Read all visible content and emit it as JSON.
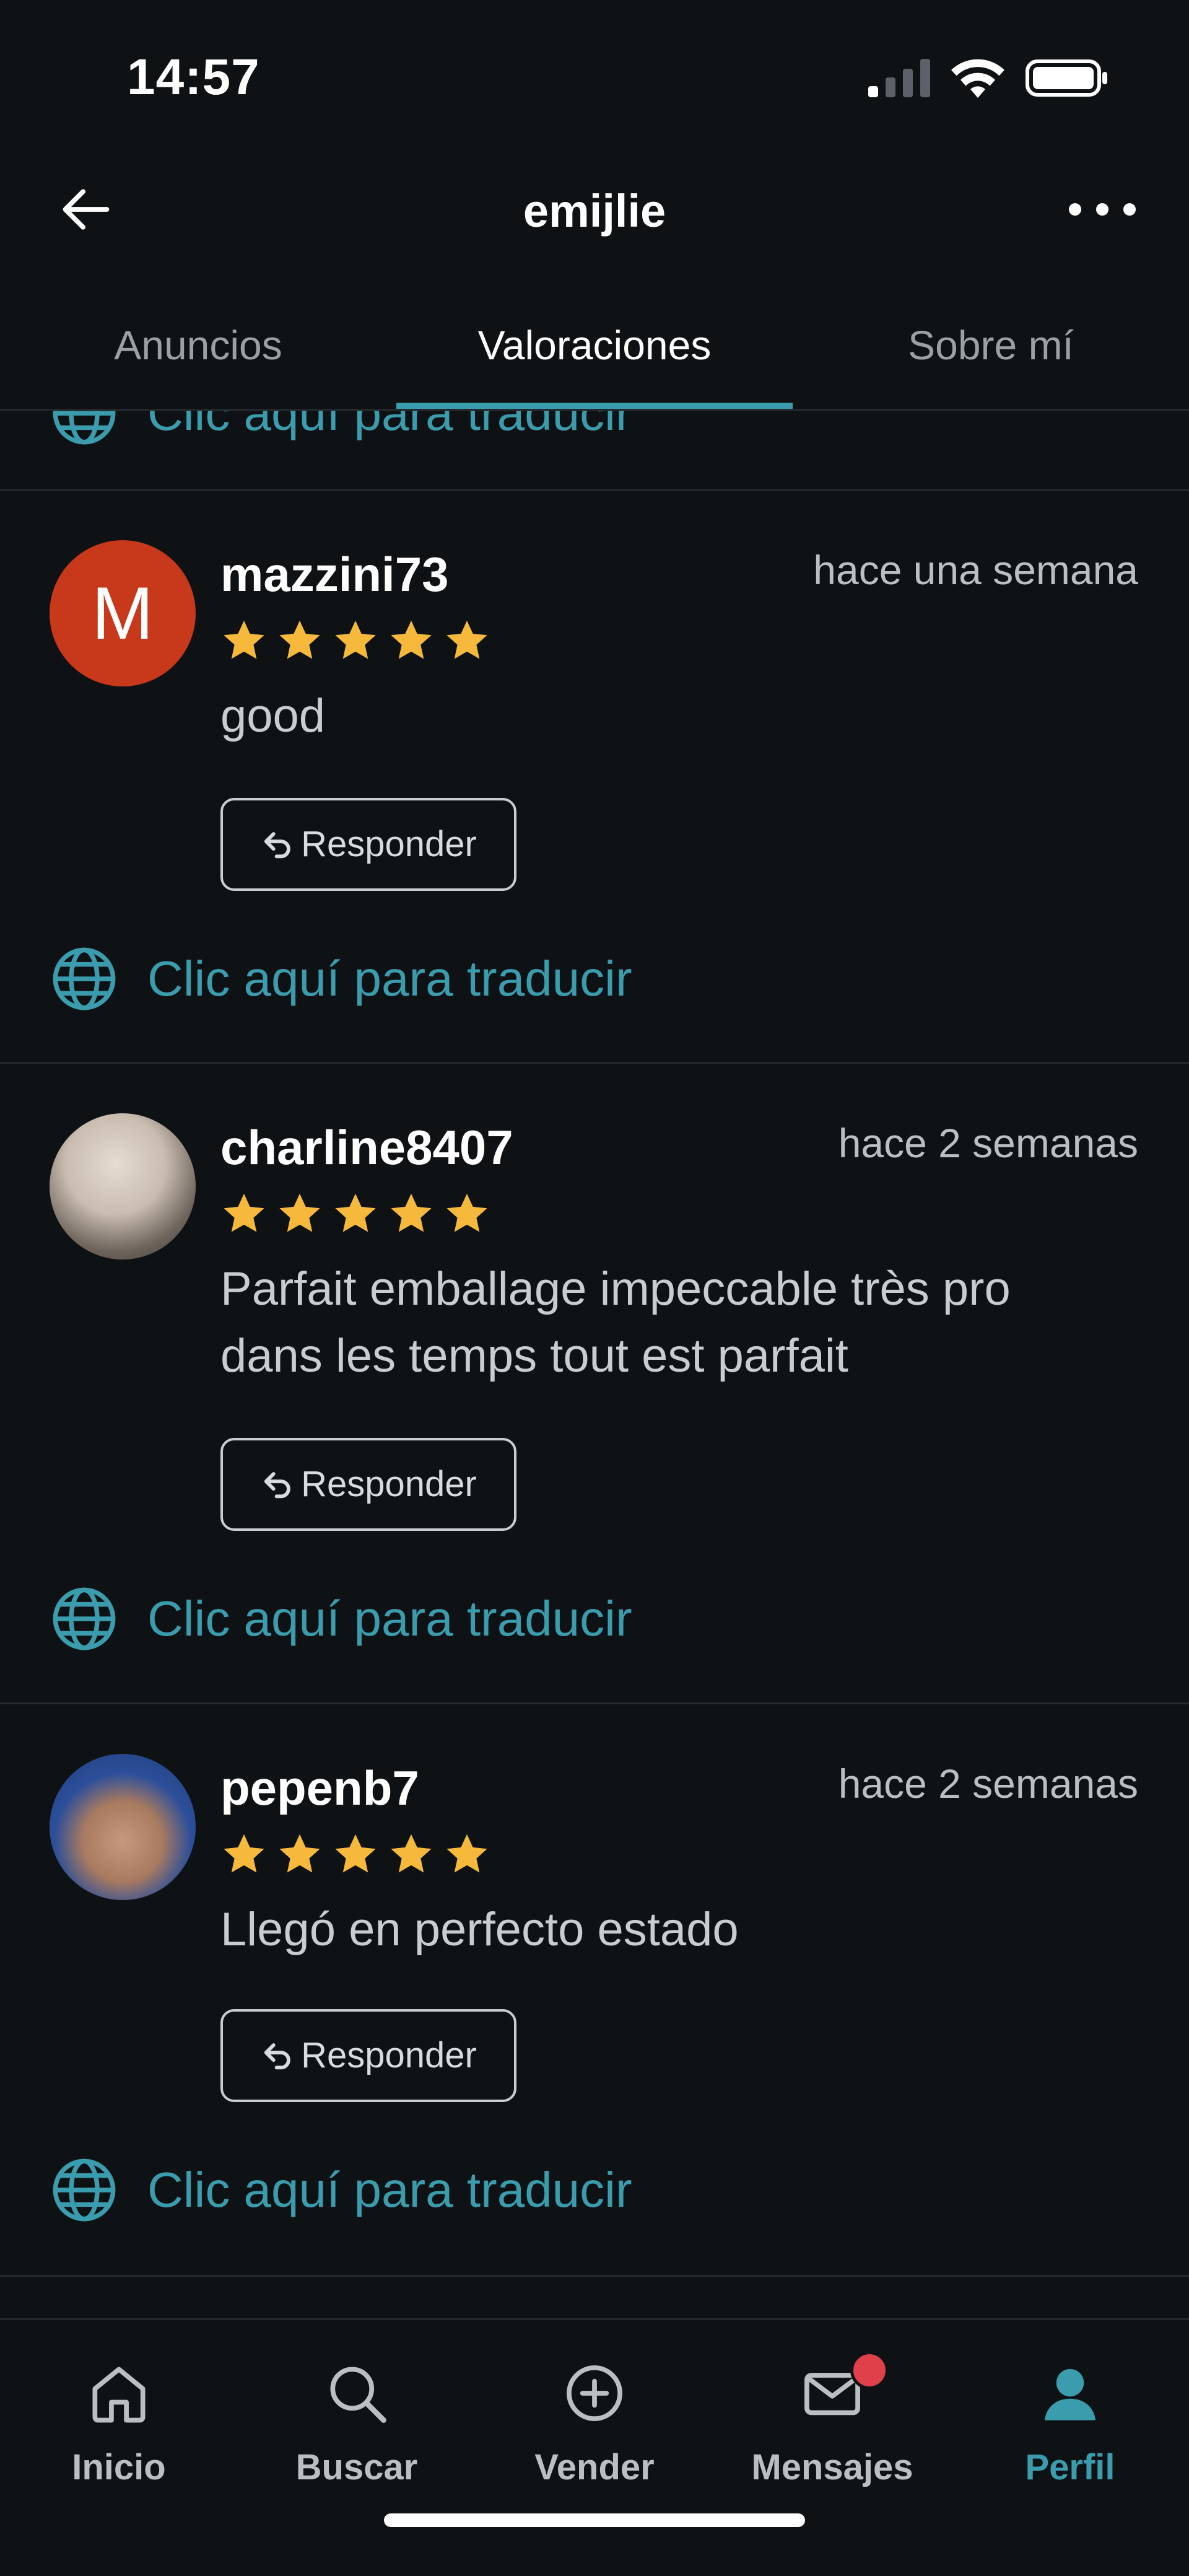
{
  "status_bar": {
    "time": "14:57"
  },
  "header": {
    "title": "emijlie"
  },
  "tabs": [
    {
      "label": "Anuncios"
    },
    {
      "label": "Valoraciones"
    },
    {
      "label": "Sobre mí"
    }
  ],
  "translate_label": "Clic aquí para traducir",
  "reviews": [
    {
      "username": "mazzini73",
      "avatar_letter": "M",
      "date": "hace una semana",
      "rating": 5,
      "comment": "good",
      "reply_label": "Responder"
    },
    {
      "username": "charline8407",
      "date": "hace 2 semanas",
      "rating": 5,
      "comment": "Parfait emballage impeccable très pro dans les temps tout est parfait",
      "reply_label": "Responder"
    },
    {
      "username": "pepenb7",
      "date": "hace 2 semanas",
      "rating": 5,
      "comment": "Llegó en perfecto estado",
      "reply_label": "Responder"
    }
  ],
  "bottom_nav": [
    {
      "label": "Inicio"
    },
    {
      "label": "Buscar"
    },
    {
      "label": "Vender"
    },
    {
      "label": "Mensajes"
    },
    {
      "label": "Perfil"
    }
  ],
  "colors": {
    "accent": "#3a9cad",
    "background": "#0f1214",
    "star": "#f6b93b",
    "avatar_m": "#c8381b",
    "badge": "#e0404a"
  }
}
